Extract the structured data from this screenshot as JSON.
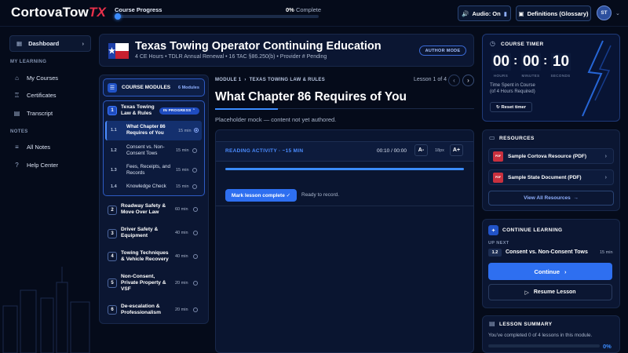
{
  "app": {
    "logo_main": "CortovaTow",
    "logo_accent": "TX"
  },
  "top": {
    "progress_label": "Course Progress",
    "progress_pct": "0%",
    "progress_suffix": "Complete",
    "progress_value": 0,
    "audio_label": "Audio: On",
    "definitions_label": "Definitions (Glossary)",
    "avatar_initials": "ST"
  },
  "sidebar": {
    "dashboard": "Dashboard",
    "section_learning": "MY LEARNING",
    "learning_items": [
      "My Courses",
      "Certificates",
      "Transcript"
    ],
    "section_notes": "NOTES",
    "notes_items": [
      "All Notes",
      "Help Center"
    ]
  },
  "course": {
    "title": "Texas Towing Operator Continuing Education",
    "subtitle": "4 CE Hours • TDLR Annual Renewal • 16 TAC §86.250(b) • Provider # Pending",
    "mode_badge": "AUTHOR MODE"
  },
  "modules": {
    "header": "COURSE MODULES",
    "count": "6 Modules",
    "in_progress": "IN PROGRESS",
    "items": [
      {
        "num": "1",
        "title": "Texas Towing Law & Rules",
        "min": ""
      },
      {
        "num": "2",
        "title": "Roadway Safety & Move Over Law",
        "min": "60 min"
      },
      {
        "num": "3",
        "title": "Driver Safety & Equipment",
        "min": "40 min"
      },
      {
        "num": "4",
        "title": "Towing Techniques & Vehicle Recovery",
        "min": "40 min"
      },
      {
        "num": "5",
        "title": "Non-Consent, Private Property & VSF",
        "min": "20 min"
      },
      {
        "num": "6",
        "title": "De-escalation & Professionalism",
        "min": "20 min"
      }
    ],
    "lessons": [
      {
        "num": "1.1",
        "title": "What Chapter 86 Requires of You",
        "min": "15 min"
      },
      {
        "num": "1.2",
        "title": "Consent vs. Non-Consent Tows",
        "min": "15 min"
      },
      {
        "num": "1.3",
        "title": "Fees, Receipts, and Records",
        "min": "15 min"
      },
      {
        "num": "1.4",
        "title": "Knowledge Check",
        "min": "15 min"
      }
    ]
  },
  "lesson": {
    "crumb_module": "MODULE 1",
    "crumb_section": "TEXAS TOWING LAW & RULES",
    "counter": "Lesson 1 of 4",
    "title": "What Chapter 86 Requires of You",
    "placeholder": "Placeholder mock — content not yet authored.",
    "reading_label": "READING ACTIVITY · ~15 MIN",
    "time": "00:10 / 00:00",
    "font_minus": "A-",
    "font_size": "18px",
    "font_plus": "A+",
    "mark_complete": "Mark lesson complete ✓",
    "ready": "Ready to record."
  },
  "timer": {
    "header": "COURSE TIMER",
    "hours": "00",
    "minutes": "00",
    "seconds": "10",
    "hours_lbl": "HOURS",
    "minutes_lbl": "MINUTES",
    "seconds_lbl": "SECONDS",
    "spent_line1": "Time Spent in Course",
    "spent_line2": "(of 4 Hours Required)",
    "reset": "Reset timer"
  },
  "resources": {
    "header": "RESOURCES",
    "items": [
      "Sample Cortova Resource (PDF)",
      "Sample State Document (PDF)"
    ],
    "pdf_tag": "PDF",
    "view_all": "View All Resources"
  },
  "continue": {
    "header": "CONTINUE LEARNING",
    "up_next": "UP NEXT",
    "num": "1.2",
    "title": "Consent vs. Non-Consent Tows",
    "min": "15 min",
    "continue_btn": "Continue",
    "resume_btn": "Resume Lesson"
  },
  "summary": {
    "header": "LESSON SUMMARY",
    "text": "You've completed 0 of 4 lessons in this module.",
    "pct": "0%",
    "value": 0
  },
  "colors": {
    "accent": "#2e6ff0",
    "brand_red": "#e8304a",
    "bg": "#050b1a"
  }
}
